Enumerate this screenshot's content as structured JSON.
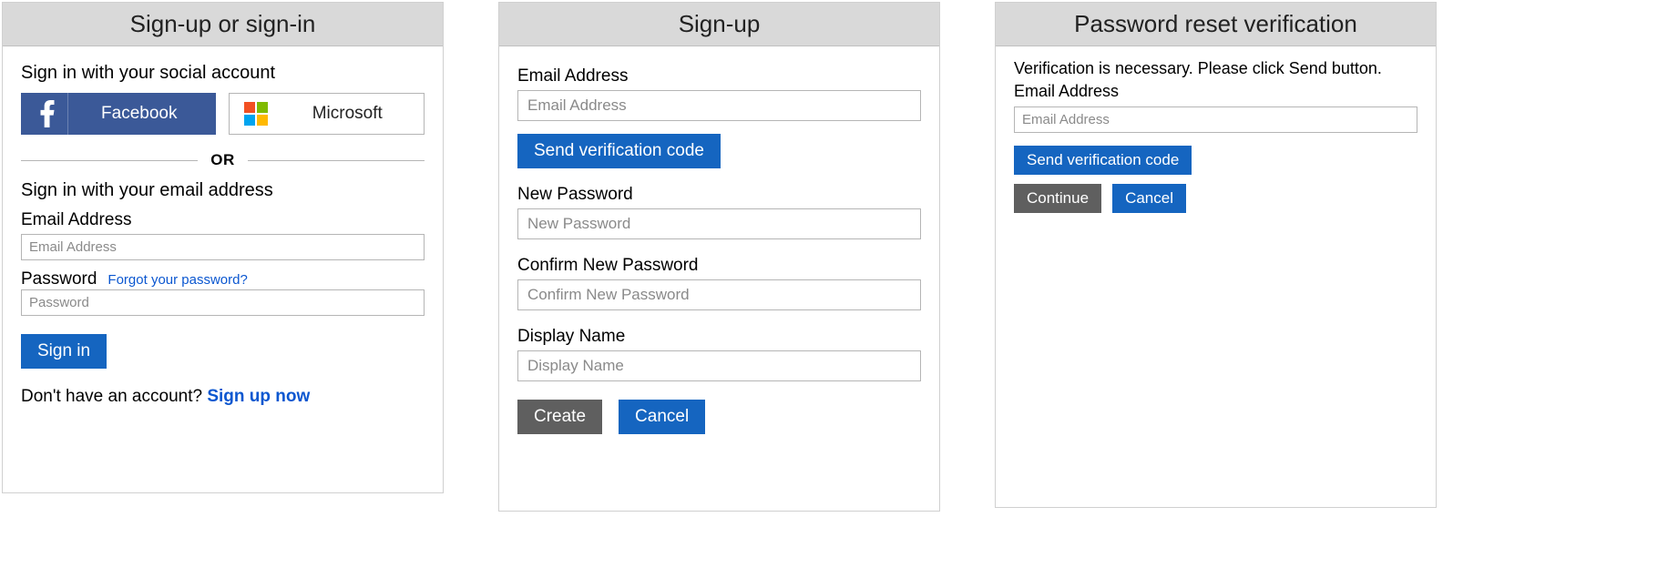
{
  "signin": {
    "title": "Sign-up or sign-in",
    "social_heading": "Sign in with your social account",
    "facebook_label": "Facebook",
    "microsoft_label": "Microsoft",
    "divider_text": "OR",
    "local_heading": "Sign in with your email address",
    "email_label": "Email Address",
    "email_placeholder": "Email Address",
    "password_label": "Password",
    "forgot_link": "Forgot your password?",
    "password_placeholder": "Password",
    "signin_button": "Sign in",
    "no_account_text": "Don't have an account? ",
    "signup_link": "Sign up now"
  },
  "signup": {
    "title": "Sign-up",
    "email_label": "Email Address",
    "email_placeholder": "Email Address",
    "send_code_button": "Send verification code",
    "new_password_label": "New Password",
    "new_password_placeholder": "New Password",
    "confirm_password_label": "Confirm New Password",
    "confirm_password_placeholder": "Confirm New Password",
    "display_name_label": "Display Name",
    "display_name_placeholder": "Display Name",
    "create_button": "Create",
    "cancel_button": "Cancel"
  },
  "reset": {
    "title": "Password reset verification",
    "message": "Verification is necessary. Please click Send button.",
    "email_label": "Email Address",
    "email_placeholder": "Email Address",
    "send_code_button": "Send verification code",
    "continue_button": "Continue",
    "cancel_button": "Cancel"
  }
}
